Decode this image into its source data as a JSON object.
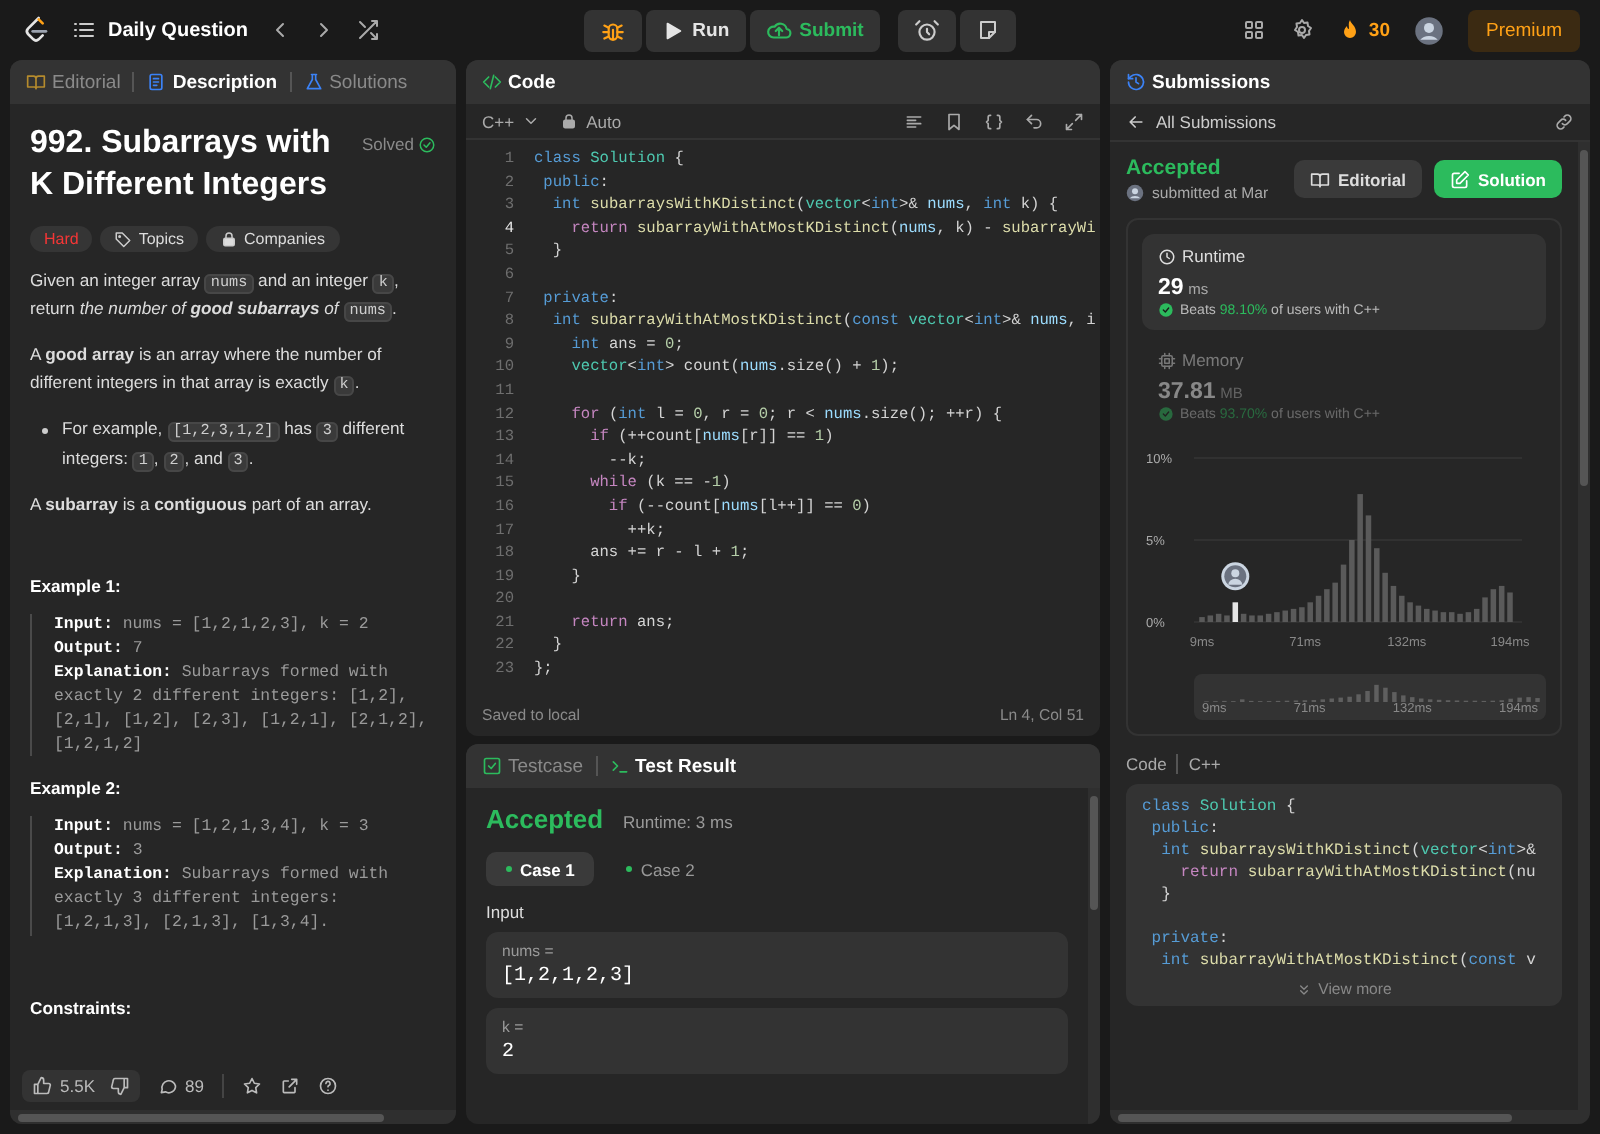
{
  "top_bar": {
    "problem_list": "Daily Question",
    "run": "Run",
    "submit": "Submit",
    "streak": "30",
    "premium": "Premium"
  },
  "description": {
    "tabs": [
      {
        "label": "Editorial",
        "selected": false
      },
      {
        "label": "Description",
        "selected": true
      },
      {
        "label": "Solutions",
        "selected": false
      }
    ],
    "title": "992. Subarrays with K Different Integers",
    "status": "Solved",
    "difficulty": "Hard",
    "tags": [
      "Topics",
      "Companies"
    ],
    "blocks": [
      {
        "kind": "paragraph",
        "parts": [
          {
            "kind": "text",
            "t": "Given an integer array "
          },
          {
            "kind": "code",
            "t": "nums"
          },
          {
            "kind": "text",
            "t": " and an integer "
          },
          {
            "kind": "code",
            "t": "k"
          },
          {
            "kind": "text",
            "t": ", return "
          },
          {
            "kind": "em",
            "t": "the number of **good subarrays** of "
          },
          {
            "kind": "code",
            "t": "nums"
          },
          {
            "kind": "text",
            "t": "."
          }
        ]
      },
      {
        "kind": "paragraph",
        "parts": [
          {
            "kind": "text",
            "t": "A **good array** is an array where the number of different integers in that array is exactly "
          },
          {
            "kind": "code",
            "t": "k"
          },
          {
            "kind": "text",
            "t": "."
          }
        ]
      },
      {
        "kind": "bullets",
        "items": [
          {
            "parts": [
              {
                "kind": "text",
                "t": "For example, "
              },
              {
                "kind": "code",
                "t": "[1,2,3,1,2]"
              },
              {
                "kind": "text",
                "t": " has "
              },
              {
                "kind": "code",
                "t": "3"
              },
              {
                "kind": "text",
                "t": " different integers: "
              },
              {
                "kind": "code",
                "t": "1"
              },
              {
                "kind": "text",
                "t": ", "
              },
              {
                "kind": "code",
                "t": "2"
              },
              {
                "kind": "text",
                "t": ", and "
              },
              {
                "kind": "code",
                "t": "3"
              },
              {
                "kind": "text",
                "t": "."
              }
            ]
          }
        ]
      },
      {
        "kind": "paragraph",
        "parts": [
          {
            "kind": "text",
            "t": "A **subarray** is a **contiguous** part of an array."
          }
        ]
      }
    ],
    "examples": [
      {
        "heading": "Example 1:",
        "lines": [
          {
            "label": "Input:",
            "value": "nums = [1,2,1,2,3], k = 2"
          },
          {
            "label": "Output:",
            "value": "7"
          },
          {
            "label": "Explanation:",
            "value": "Subarrays formed with exactly 2 different integers: [1,2], [2,1], [1,2], [2,3], [1,2,1], [2,1,2], [1,2,1,2]"
          }
        ]
      },
      {
        "heading": "Example 2:",
        "lines": [
          {
            "label": "Input:",
            "value": "nums = [1,2,1,3,4], k = 3"
          },
          {
            "label": "Output:",
            "value": "3"
          },
          {
            "label": "Explanation:",
            "value": "Subarrays formed with exactly 3 different integers: [1,2,1,3], [2,1,3], [1,3,4]."
          }
        ]
      }
    ],
    "constraints_heading": "Constraints:",
    "likes": "5.5K",
    "comments": "89"
  },
  "editor": {
    "title": "Code",
    "language": "C++",
    "mode": "Auto",
    "lines": [
      {
        "n": "1",
        "current": false,
        "tokens": [
          {
            "kind": "kw",
            "t": "class"
          },
          {
            "kind": "type",
            "t": " Solution"
          },
          {
            "kind": "p",
            "t": " {"
          }
        ]
      },
      {
        "n": "2",
        "current": false,
        "tokens": [
          {
            "kind": "kw",
            "t": " public"
          },
          {
            "kind": "p",
            "t": ":"
          }
        ]
      },
      {
        "n": "3",
        "current": false,
        "tokens": [
          {
            "kind": "kw",
            "t": "  int"
          },
          {
            "kind": "fn",
            "t": " subarraysWithKDistinct"
          },
          {
            "kind": "p",
            "t": "("
          },
          {
            "kind": "type",
            "t": "vector"
          },
          {
            "kind": "p",
            "t": "<"
          },
          {
            "kind": "kw",
            "t": "int"
          },
          {
            "kind": "p",
            "t": ">& "
          },
          {
            "kind": "var",
            "t": "nums"
          },
          {
            "kind": "p",
            "t": ", "
          },
          {
            "kind": "kw",
            "t": "int"
          },
          {
            "kind": "p",
            "t": " k) {"
          }
        ]
      },
      {
        "n": "4",
        "current": true,
        "tokens": [
          {
            "kind": "ctrl",
            "t": "    return"
          },
          {
            "kind": "fn",
            "t": " subarrayWithAtMostKDistinct"
          },
          {
            "kind": "p",
            "t": "("
          },
          {
            "kind": "var",
            "t": "nums"
          },
          {
            "kind": "p",
            "t": ", k) - "
          },
          {
            "kind": "fn",
            "t": "subarrayWi"
          }
        ]
      },
      {
        "n": "5",
        "current": false,
        "tokens": [
          {
            "kind": "p",
            "t": "  }"
          }
        ]
      },
      {
        "n": "6",
        "current": false
      },
      {
        "n": "7",
        "current": false,
        "tokens": [
          {
            "kind": "kw",
            "t": " private"
          },
          {
            "kind": "p",
            "t": ":"
          }
        ]
      },
      {
        "n": "8",
        "current": false,
        "tokens": [
          {
            "kind": "kw",
            "t": "  int"
          },
          {
            "kind": "fn",
            "t": " subarrayWithAtMostKDistinct"
          },
          {
            "kind": "p",
            "t": "("
          },
          {
            "kind": "kw",
            "t": "const"
          },
          {
            "kind": "type",
            "t": " vector"
          },
          {
            "kind": "p",
            "t": "<"
          },
          {
            "kind": "kw",
            "t": "int"
          },
          {
            "kind": "p",
            "t": ">& "
          },
          {
            "kind": "var",
            "t": "nums"
          },
          {
            "kind": "p",
            "t": ", i"
          }
        ]
      },
      {
        "n": "9",
        "current": false,
        "tokens": [
          {
            "kind": "kw",
            "t": "    int"
          },
          {
            "kind": "p",
            "t": " ans = "
          },
          {
            "kind": "num",
            "t": "0"
          },
          {
            "kind": "p",
            "t": ";"
          }
        ]
      },
      {
        "n": "10",
        "current": false,
        "tokens": [
          {
            "kind": "type",
            "t": "    vector"
          },
          {
            "kind": "p",
            "t": "<"
          },
          {
            "kind": "kw",
            "t": "int"
          },
          {
            "kind": "p",
            "t": "> count("
          },
          {
            "kind": "var",
            "t": "nums"
          },
          {
            "kind": "p",
            "t": ".size() + "
          },
          {
            "kind": "num",
            "t": "1"
          },
          {
            "kind": "p",
            "t": ");"
          }
        ]
      },
      {
        "n": "11",
        "current": false
      },
      {
        "n": "12",
        "current": false,
        "tokens": [
          {
            "kind": "ctrl",
            "t": "    for"
          },
          {
            "kind": "p",
            "t": " ("
          },
          {
            "kind": "kw",
            "t": "int"
          },
          {
            "kind": "p",
            "t": " l = "
          },
          {
            "kind": "num",
            "t": "0"
          },
          {
            "kind": "p",
            "t": ", r = "
          },
          {
            "kind": "num",
            "t": "0"
          },
          {
            "kind": "p",
            "t": "; r < "
          },
          {
            "kind": "var",
            "t": "nums"
          },
          {
            "kind": "p",
            "t": ".size(); ++r) {"
          }
        ]
      },
      {
        "n": "13",
        "current": false,
        "tokens": [
          {
            "kind": "ctrl",
            "t": "      if"
          },
          {
            "kind": "p",
            "t": " (++count["
          },
          {
            "kind": "var",
            "t": "nums"
          },
          {
            "kind": "p",
            "t": "[r]] == "
          },
          {
            "kind": "num",
            "t": "1"
          },
          {
            "kind": "p",
            "t": ")"
          }
        ]
      },
      {
        "n": "14",
        "current": false,
        "tokens": [
          {
            "kind": "p",
            "t": "        --k;"
          }
        ]
      },
      {
        "n": "15",
        "current": false,
        "tokens": [
          {
            "kind": "ctrl",
            "t": "      while"
          },
          {
            "kind": "p",
            "t": " (k == -"
          },
          {
            "kind": "num",
            "t": "1"
          },
          {
            "kind": "p",
            "t": ")"
          }
        ]
      },
      {
        "n": "16",
        "current": false,
        "tokens": [
          {
            "kind": "ctrl",
            "t": "        if"
          },
          {
            "kind": "p",
            "t": " (--count["
          },
          {
            "kind": "var",
            "t": "nums"
          },
          {
            "kind": "p",
            "t": "[l++]] == "
          },
          {
            "kind": "num",
            "t": "0"
          },
          {
            "kind": "p",
            "t": ")"
          }
        ]
      },
      {
        "n": "17",
        "current": false,
        "tokens": [
          {
            "kind": "p",
            "t": "          ++k;"
          }
        ]
      },
      {
        "n": "18",
        "current": false,
        "tokens": [
          {
            "kind": "p",
            "t": "      ans += r - l + "
          },
          {
            "kind": "num",
            "t": "1"
          },
          {
            "kind": "p",
            "t": ";"
          }
        ]
      },
      {
        "n": "19",
        "current": false,
        "tokens": [
          {
            "kind": "p",
            "t": "    }"
          }
        ]
      },
      {
        "n": "20",
        "current": false
      },
      {
        "n": "21",
        "current": false,
        "tokens": [
          {
            "kind": "ctrl",
            "t": "    return"
          },
          {
            "kind": "p",
            "t": " ans;"
          }
        ]
      },
      {
        "n": "22",
        "current": false,
        "tokens": [
          {
            "kind": "p",
            "t": "  }"
          }
        ]
      },
      {
        "n": "23",
        "current": false,
        "tokens": [
          {
            "kind": "p",
            "t": "};"
          }
        ]
      }
    ],
    "save_status": "Saved to local",
    "cursor": "Ln 4, Col 51"
  },
  "test_panel": {
    "tabs": [
      {
        "label": "Testcase",
        "selected": false
      },
      {
        "label": "Test Result",
        "selected": true
      }
    ],
    "verdict": "Accepted",
    "runtime": "Runtime: 3 ms",
    "cases": [
      {
        "label": "Case 1",
        "selected": true,
        "passed": true
      },
      {
        "label": "Case 2",
        "selected": false,
        "passed": true
      }
    ],
    "input_heading": "Input",
    "inputs": [
      {
        "label": "nums =",
        "value": "[1,2,1,2,3]"
      },
      {
        "label": "k =",
        "value": "2"
      }
    ]
  },
  "submission": {
    "title": "Submissions",
    "back": "All Submissions",
    "verdict": "Accepted",
    "submitted": "submitted at Mar",
    "buttons": [
      {
        "kind": "secondary",
        "label": "Editorial"
      },
      {
        "kind": "primary",
        "label": "Solution"
      }
    ],
    "metrics": [
      {
        "kind": "runtime",
        "label": "Runtime",
        "value": "29",
        "unit": "ms",
        "beats_label": "Beats",
        "beats": "98.10%",
        "suffix": "of users with C++",
        "selected": true
      },
      {
        "kind": "memory",
        "label": "Memory",
        "value": "37.81",
        "unit": "MB",
        "beats_label": "Beats",
        "beats": "93.70%",
        "suffix": "of users with C++",
        "selected": false
      }
    ],
    "chart_data": {
      "type": "bar",
      "x": [
        9,
        14,
        19,
        24,
        29,
        34,
        39,
        44,
        49,
        54,
        59,
        64,
        69,
        74,
        79,
        84,
        89,
        94,
        99,
        104,
        109,
        114,
        119,
        124,
        129,
        134,
        139,
        144,
        149,
        154,
        159,
        164,
        169,
        174,
        179,
        184,
        189,
        194
      ],
      "values": [
        0.3,
        0.4,
        0.5,
        0.4,
        1.2,
        0.5,
        0.4,
        0.4,
        0.5,
        0.6,
        0.7,
        0.8,
        0.9,
        1.2,
        1.6,
        2.0,
        2.4,
        3.5,
        5.0,
        7.8,
        6.5,
        4.5,
        3.0,
        2.2,
        1.6,
        1.2,
        1.0,
        0.8,
        0.7,
        0.6,
        0.6,
        0.5,
        0.6,
        0.8,
        1.5,
        2.0,
        2.2,
        1.8
      ],
      "xlim": [
        9,
        194
      ],
      "ylim": [
        0,
        10
      ],
      "xticks": [
        {
          "value": 9,
          "label": "9ms"
        },
        {
          "value": 71,
          "label": "71ms"
        },
        {
          "value": 132,
          "label": "132ms"
        },
        {
          "value": 194,
          "label": "194ms"
        }
      ],
      "yticks": [
        {
          "value": 0,
          "label": "0%"
        },
        {
          "value": 5,
          "label": "5%"
        },
        {
          "value": 10,
          "label": "10%"
        }
      ]
    },
    "overview_labels": [
      "9ms",
      "71ms",
      "132ms",
      "194ms"
    ],
    "code_heading": "Code",
    "code_language": "C++",
    "code_preview": [
      {
        "tokens": [
          {
            "kind": "kw",
            "t": "class"
          },
          {
            "kind": "type",
            "t": " Solution"
          },
          {
            "kind": "p",
            "t": " {"
          }
        ]
      },
      {
        "tokens": [
          {
            "kind": "kw",
            "t": " public"
          },
          {
            "kind": "p",
            "t": ":"
          }
        ]
      },
      {
        "tokens": [
          {
            "kind": "kw",
            "t": "  int"
          },
          {
            "kind": "fn",
            "t": " subarraysWithKDistinct"
          },
          {
            "kind": "p",
            "t": "("
          },
          {
            "kind": "type",
            "t": "vector"
          },
          {
            "kind": "p",
            "t": "<"
          },
          {
            "kind": "kw",
            "t": "int"
          },
          {
            "kind": "p",
            "t": ">&"
          }
        ]
      },
      {
        "tokens": [
          {
            "kind": "ctrl",
            "t": "    return"
          },
          {
            "kind": "fn",
            "t": " subarrayWithAtMostKDistinct"
          },
          {
            "kind": "p",
            "t": "(nu"
          }
        ]
      },
      {
        "tokens": [
          {
            "kind": "p",
            "t": "  }"
          }
        ]
      },
      {
        "blank": true
      },
      {
        "tokens": [
          {
            "kind": "kw",
            "t": " private"
          },
          {
            "kind": "p",
            "t": ":"
          }
        ]
      },
      {
        "tokens": [
          {
            "kind": "kw",
            "t": "  int"
          },
          {
            "kind": "fn",
            "t": " subarrayWithAtMostKDistinct"
          },
          {
            "kind": "p",
            "t": "("
          },
          {
            "kind": "kw",
            "t": "const"
          },
          {
            "kind": "p",
            "t": " v"
          }
        ]
      }
    ],
    "view_more": "View more"
  }
}
